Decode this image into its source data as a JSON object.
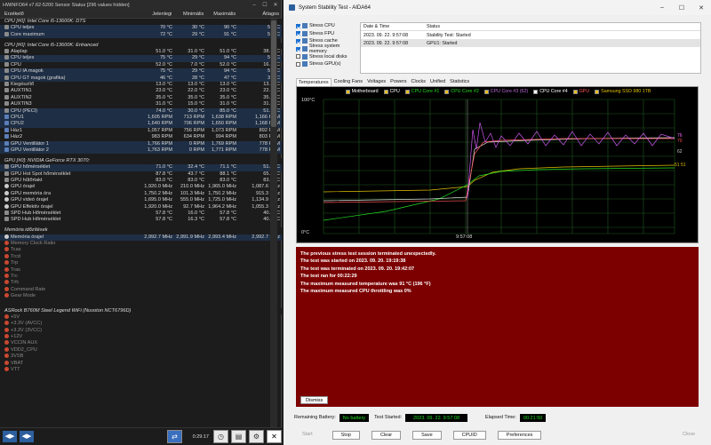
{
  "hwinfo": {
    "title": "HWiNFO64 v7.62-5200 Sensor Status [296 values hidden]",
    "columns": [
      "Érzékelő",
      "Jelenlegi",
      "Minimális",
      "Maximális",
      "Átlagos"
    ],
    "rows": [
      {
        "t": "sec",
        "n": "CPU [#0]: Intel Core i5-13600K: DTS"
      },
      {
        "t": "s",
        "n": "CPU teljes",
        "v": [
          "70 °C",
          "30 °C",
          "90 °C",
          "52 °C"
        ],
        "hl": true
      },
      {
        "t": "s",
        "n": "Core maximum",
        "v": [
          "72 °C",
          "29 °C",
          "91 °C",
          "52 °C"
        ],
        "hl": true
      },
      {
        "t": "gap"
      },
      {
        "t": "sec",
        "n": "CPU [#0]: Intel Core i5-13600K: Enhanced"
      },
      {
        "t": "s",
        "n": "Alaplap",
        "v": [
          "51.0 °C",
          "31.0 °C",
          "51.0 °C",
          "38.7 °C"
        ]
      },
      {
        "t": "s",
        "n": "CPU teljes",
        "v": [
          "75 °C",
          "29 °C",
          "94 °C",
          "52 °C"
        ],
        "hl": true
      },
      {
        "t": "s",
        "n": "CPU",
        "v": [
          "52.0 °C",
          "7.0 °C",
          "52.0 °C",
          "16.5 °C"
        ]
      },
      {
        "t": "s",
        "n": "CPU IA magok",
        "v": [
          "75 °C",
          "29 °C",
          "94 °C",
          "52 °C"
        ],
        "hl": true
      },
      {
        "t": "s",
        "n": "CPU GT magok (grafika)",
        "v": [
          "46 °C",
          "28 °C",
          "47 °C",
          "37 °C"
        ],
        "hl": true
      },
      {
        "t": "s",
        "n": "Kiegészítő",
        "v": [
          "13.0 °C",
          "13.0 °C",
          "13.0 °C",
          "13.0 °C"
        ]
      },
      {
        "t": "s",
        "n": "AUXTIN1",
        "v": [
          "23.0 °C",
          "22.0 °C",
          "23.0 °C",
          "22.4 °C"
        ]
      },
      {
        "t": "s",
        "n": "AUXTIN2",
        "v": [
          "35.0 °C",
          "35.0 °C",
          "35.0 °C",
          "35.0 °C"
        ]
      },
      {
        "t": "s",
        "n": "AUXTIN3",
        "v": [
          "31.0 °C",
          "15.0 °C",
          "31.0 °C",
          "31.0 °C"
        ]
      },
      {
        "t": "s",
        "n": "CPU (PECI)",
        "v": [
          "74.0 °C",
          "30.0 °C",
          "85.0 °C",
          "51.6 °C"
        ],
        "hl": true
      },
      {
        "t": "b",
        "n": "CPU1",
        "v": [
          "1,605 RPM",
          "713 RPM",
          "1,638 RPM",
          "1,166 RPM"
        ],
        "hl": true
      },
      {
        "t": "b",
        "n": "CPU2",
        "v": [
          "1,640 RPM",
          "706 RPM",
          "1,650 RPM",
          "1,168 RPM"
        ],
        "hl": true
      },
      {
        "t": "b",
        "n": "Ház1",
        "v": [
          "1,057 RPM",
          "756 RPM",
          "1,073 RPM",
          "892 RPM"
        ]
      },
      {
        "t": "b",
        "n": "Ház2",
        "v": [
          "983 RPM",
          "634 RPM",
          "994 RPM",
          "803 RPM"
        ]
      },
      {
        "t": "b",
        "n": "GPU Ventillátor 1",
        "v": [
          "1,766 RPM",
          "0 RPM",
          "1,769 RPM",
          "778 RPM"
        ],
        "hl": true
      },
      {
        "t": "b",
        "n": "GPU Ventillátor 2",
        "v": [
          "1,763 RPM",
          "0 RPM",
          "1,771 RPM",
          "778 RPM"
        ],
        "hl": true
      },
      {
        "t": "gap"
      },
      {
        "t": "sec",
        "n": "GPU [#0]: NVIDIA GeForce RTX 3070:"
      },
      {
        "t": "s",
        "n": "GPU hőmérséklet",
        "v": [
          "71.0 °C",
          "32.4 °C",
          "71.1 °C",
          "51.4 °C"
        ],
        "hl": true
      },
      {
        "t": "s",
        "n": "GPU Hot Spot hőmérséklet",
        "v": [
          "87.8 °C",
          "43.7 °C",
          "88.1 °C",
          "65.2 °C"
        ]
      },
      {
        "t": "s",
        "n": "GPU hűtőrtakt",
        "v": [
          "83.0 °C",
          "83.0 °C",
          "83.0 °C",
          "83.0 °C"
        ]
      },
      {
        "t": "c",
        "n": "GPU órajel",
        "v": [
          "1,920.0 MHz",
          "210.0 MHz",
          "1,965.0 MHz",
          "1,087.6 MHz"
        ]
      },
      {
        "t": "c",
        "n": "GPU memória óra",
        "v": [
          "1,750.2 MHz",
          "101.3 MHz",
          "1,750.2 MHz",
          "915.3 MHz"
        ]
      },
      {
        "t": "c",
        "n": "GPU videó órajel",
        "v": [
          "1,695.0 MHz",
          "555.0 MHz",
          "1,725.0 MHz",
          "1,134.9 MHz"
        ]
      },
      {
        "t": "c",
        "n": "GPU Effektív órajel",
        "v": [
          "1,920.0 MHz",
          "92.7 MHz",
          "1,964.2 MHz",
          "1,055.3 MHz"
        ]
      },
      {
        "t": "s",
        "n": "SPD Hub Hőmérséklet",
        "v": [
          "57.8 °C",
          "16.0 °C",
          "57.8 °C",
          "40.7 °C"
        ]
      },
      {
        "t": "s",
        "n": "SPD Hub Hőmérséklet",
        "v": [
          "57.8 °C",
          "16.3 °C",
          "57.8 °C",
          "40.7 °C"
        ]
      },
      {
        "t": "gap"
      },
      {
        "t": "sec",
        "n": "Memória időzítések"
      },
      {
        "t": "c",
        "n": "Memória órajel",
        "v": [
          "2,992.7 MHz",
          "2,991.9 MHz",
          "2,993.4 MHz",
          "2,992.7 MHz"
        ],
        "hl": true
      },
      {
        "t": "r",
        "n": "Memory Clock Ratio",
        "dim": true
      },
      {
        "t": "r",
        "n": "Tcas",
        "dim": true
      },
      {
        "t": "r",
        "n": "Trcd",
        "dim": true
      },
      {
        "t": "r",
        "n": "Trp",
        "dim": true
      },
      {
        "t": "r",
        "n": "Tras",
        "dim": true
      },
      {
        "t": "r",
        "n": "Trc",
        "dim": true
      },
      {
        "t": "r",
        "n": "Trfc",
        "dim": true
      },
      {
        "t": "r",
        "n": "Command Rate",
        "dim": true
      },
      {
        "t": "r",
        "n": "Gear Mode",
        "dim": true
      },
      {
        "t": "gap"
      },
      {
        "t": "gap"
      },
      {
        "t": "sec",
        "n": "ASRock B760M Steel Legend WiFi (Nuvoton NCT6796D)"
      },
      {
        "t": "r",
        "n": "+5V",
        "dim": true
      },
      {
        "t": "r",
        "n": "+3.3V (AVCC)",
        "dim": true
      },
      {
        "t": "r",
        "n": "+3.3V (3VCC)",
        "dim": true
      },
      {
        "t": "r",
        "n": "+12V",
        "dim": true
      },
      {
        "t": "r",
        "n": "VCCIN AUX",
        "dim": true
      },
      {
        "t": "r",
        "n": "VDD2_CPU",
        "dim": true
      },
      {
        "t": "r",
        "n": "3VSB",
        "dim": true
      },
      {
        "t": "r",
        "n": "VBAT",
        "dim": true
      },
      {
        "t": "r",
        "n": "VTT",
        "dim": true
      }
    ],
    "elapsed": "0:29:17"
  },
  "aida": {
    "title": "System Stability Test - AIDA64",
    "options": [
      {
        "label": "Stress CPU",
        "on": true
      },
      {
        "label": "Stress FPU",
        "on": true
      },
      {
        "label": "Stress cache",
        "on": true
      },
      {
        "label": "Stress system memory",
        "on": true
      },
      {
        "label": "Stress local disks",
        "on": false
      },
      {
        "label": "Stress GPU(s)",
        "on": false
      }
    ],
    "log": {
      "headers": [
        "Date & Time",
        "Status"
      ],
      "rows": [
        [
          "2023. 09. 22. 9:57:08",
          "Stability Test: Started"
        ],
        [
          "2023. 09. 22. 9:57:08",
          "GPU1: Started"
        ]
      ]
    },
    "tabs": [
      "Temperatures",
      "Cooling Fans",
      "Voltages",
      "Powers",
      "Clocks",
      "Unified",
      "Statistics"
    ],
    "legend": [
      {
        "label": "Motherboard",
        "color": "#ffffff",
        "on": true
      },
      {
        "label": "CPU",
        "color": "#ffffff",
        "on": true
      },
      {
        "label": "CPU Core #1",
        "color": "#22dd22",
        "on": true
      },
      {
        "label": "CPU Core #2",
        "color": "#22dd22",
        "on": true
      },
      {
        "label": "CPU Core #3 (62)",
        "color": "#b86bd6",
        "on": true
      },
      {
        "label": "CPU Core #4",
        "color": "#ffffff",
        "on": false
      },
      {
        "label": "GPU",
        "color": "#ff5555",
        "on": true
      },
      {
        "label": "Samsung SSD 980 1TB",
        "color": "#e0c000",
        "on": true
      }
    ],
    "graph": {
      "ymax": "100°C",
      "ymin": "0°C",
      "xlabel": "9:57:08",
      "readouts": [
        {
          "v": "76",
          "c": "#ff66ff"
        },
        {
          "v": "70",
          "c": "#ff5555"
        },
        {
          "v": "62",
          "c": "#c8c8c8"
        },
        {
          "v": "51 51",
          "c": "#e0c000"
        }
      ]
    },
    "message": [
      "The previous stress test session terminated unexpectedly.",
      "The test was started on 2023. 09. 20. 19:19:38",
      "The test was terminated on 2023. 09. 20. 19:42:07",
      "The test ran for 00:22:29",
      "The maximum measured temperature was 91 °C  (196 °F)",
      "The maximum measured CPU throttling was 0%"
    ],
    "dismiss": "Dismiss",
    "status": {
      "battery_label": "Remaining Battery:",
      "battery": "No battery",
      "started_label": "Test Started:",
      "started": "2023. 09. 22. 9:57:08",
      "elapsed_label": "Elapsed Time:",
      "elapsed": "00:21:50"
    },
    "buttons": [
      "Start",
      "Stop",
      "Clear",
      "Save",
      "CPUID",
      "Preferences",
      "Close"
    ]
  }
}
